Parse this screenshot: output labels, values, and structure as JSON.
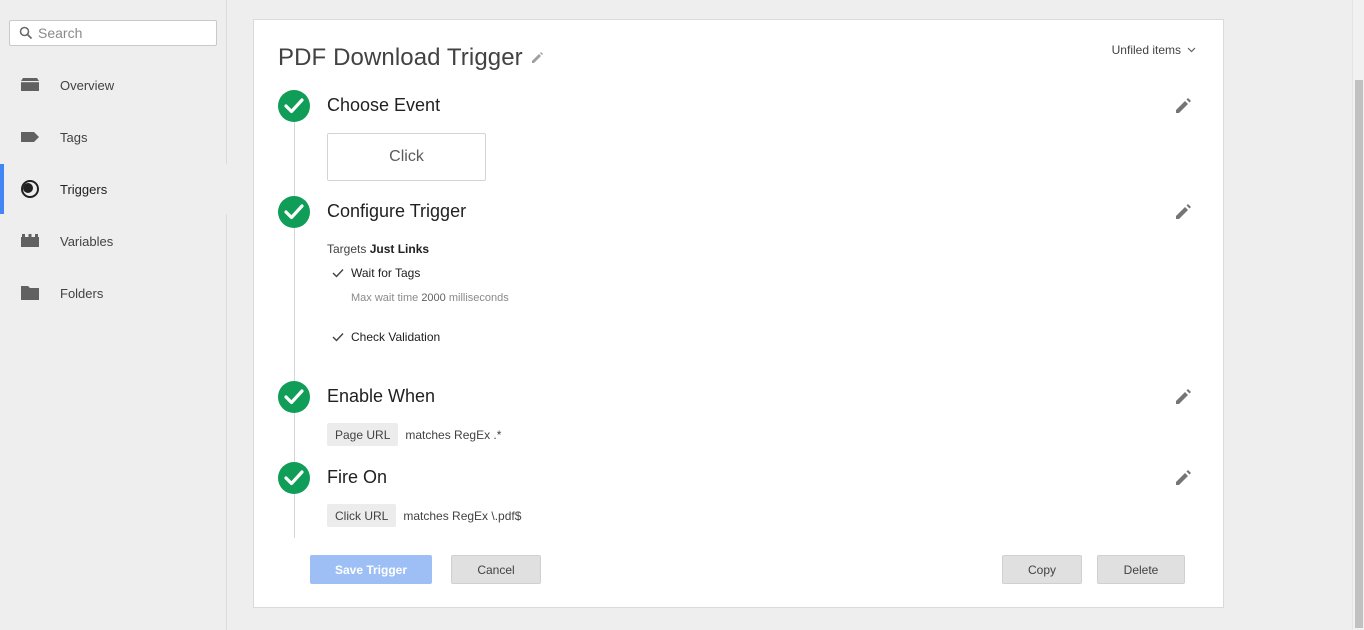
{
  "search": {
    "placeholder": "Search"
  },
  "sidebar": {
    "items": [
      {
        "label": "Overview",
        "icon": "overview-icon",
        "active": false
      },
      {
        "label": "Tags",
        "icon": "tag-icon",
        "active": false
      },
      {
        "label": "Triggers",
        "icon": "trigger-icon",
        "active": true
      },
      {
        "label": "Variables",
        "icon": "variable-icon",
        "active": false
      },
      {
        "label": "Folders",
        "icon": "folder-icon",
        "active": false
      }
    ]
  },
  "trigger": {
    "title": "PDF Download Trigger",
    "folder": "Unfiled items",
    "steps": {
      "choose_event": {
        "title": "Choose Event",
        "event": "Click"
      },
      "configure": {
        "title": "Configure Trigger",
        "targets_prefix": "Targets",
        "targets_value": "Just Links",
        "wait_for_tags": "Wait for Tags",
        "max_wait_prefix": "Max wait time",
        "max_wait_value": "2000",
        "max_wait_unit": "milliseconds",
        "check_validation": "Check Validation"
      },
      "enable_when": {
        "title": "Enable When",
        "variable": "Page URL",
        "condition": "matches RegEx .*"
      },
      "fire_on": {
        "title": "Fire On",
        "variable": "Click URL",
        "condition": "matches RegEx \\.pdf$"
      }
    }
  },
  "buttons": {
    "save": "Save Trigger",
    "cancel": "Cancel",
    "copy": "Copy",
    "delete": "Delete"
  },
  "colors": {
    "accent": "#4285f4",
    "check_green": "#0f9d58",
    "save_disabled": "#9dbff5"
  }
}
